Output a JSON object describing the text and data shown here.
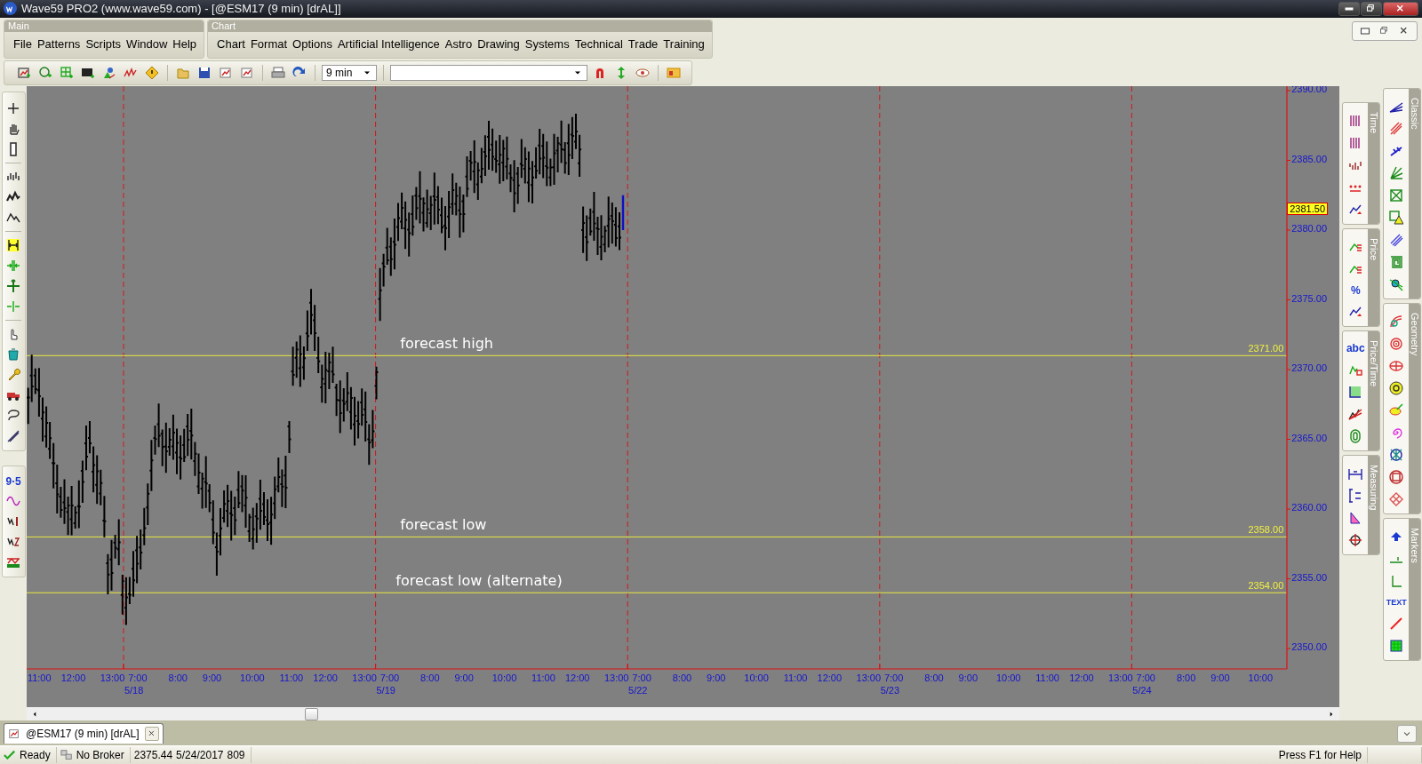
{
  "window": {
    "title": "Wave59 PRO2 (www.wave59.com) - [@ESM17 (9 min) [drAL]]"
  },
  "menus": [
    {
      "title": "Main",
      "items": [
        "File",
        "Patterns",
        "Scripts",
        "Window",
        "Help"
      ]
    },
    {
      "title": "Chart",
      "items": [
        "Chart",
        "Format",
        "Options",
        "Artificial Intelligence",
        "Astro",
        "Drawing",
        "Systems",
        "Technical",
        "Trade",
        "Training"
      ]
    }
  ],
  "toolbar": {
    "interval": "9 min"
  },
  "left_toolbar": {
    "labels": [
      "9·5"
    ]
  },
  "right_toolbars": [
    {
      "title": "Time"
    },
    {
      "title": "Price",
      "labels": [
        "%"
      ]
    },
    {
      "title": "Price/Time",
      "labels": [
        "abc"
      ]
    },
    {
      "title": "Measuring"
    },
    {
      "title": "Classic"
    },
    {
      "title": "Geometry"
    },
    {
      "title": "Markers",
      "labels": [
        "TEXT"
      ]
    }
  ],
  "chart": {
    "price_axis": [
      "2390.00",
      "2385.00",
      "2380.00",
      "2375.00",
      "2370.00",
      "2365.00",
      "2360.00",
      "2355.00",
      "2350.00"
    ],
    "last_price": "2381.50",
    "levels": [
      {
        "label": "forecast high",
        "value": "2371.00"
      },
      {
        "label": "forecast low",
        "value": "2358.00"
      },
      {
        "label": "forecast low (alternate)",
        "value": "2354.00"
      }
    ],
    "time_axis": [
      {
        "kind": "tail",
        "times": [
          "11:00",
          "12:00",
          "13:00"
        ]
      },
      {
        "kind": "day",
        "date": "5/18",
        "times": [
          "7:00",
          "8:00",
          "9:00",
          "10:00",
          "11:00",
          "12:00",
          "13:00"
        ]
      },
      {
        "kind": "day",
        "date": "5/19",
        "times": [
          "7:00",
          "8:00",
          "9:00",
          "10:00",
          "11:00",
          "12:00",
          "13:00"
        ]
      },
      {
        "kind": "day",
        "date": "5/22",
        "times": [
          "7:00",
          "8:00",
          "9:00",
          "10:00",
          "11:00",
          "12:00",
          "13:00"
        ]
      },
      {
        "kind": "day",
        "date": "5/23",
        "times": [
          "7:00",
          "8:00",
          "9:00",
          "10:00",
          "11:00",
          "12:00",
          "13:00"
        ]
      },
      {
        "kind": "day",
        "date": "5/24",
        "times": [
          "7:00",
          "8:00",
          "9:00",
          "10:00"
        ]
      }
    ]
  },
  "tab": {
    "label": "@ESM17 (9 min) [drAL]",
    "selected": true
  },
  "status_bar": {
    "state": "Ready",
    "broker": "No Broker",
    "price": "2375.44",
    "date": "5/24/2017",
    "count": "809",
    "help": "Press F1 for Help"
  }
}
